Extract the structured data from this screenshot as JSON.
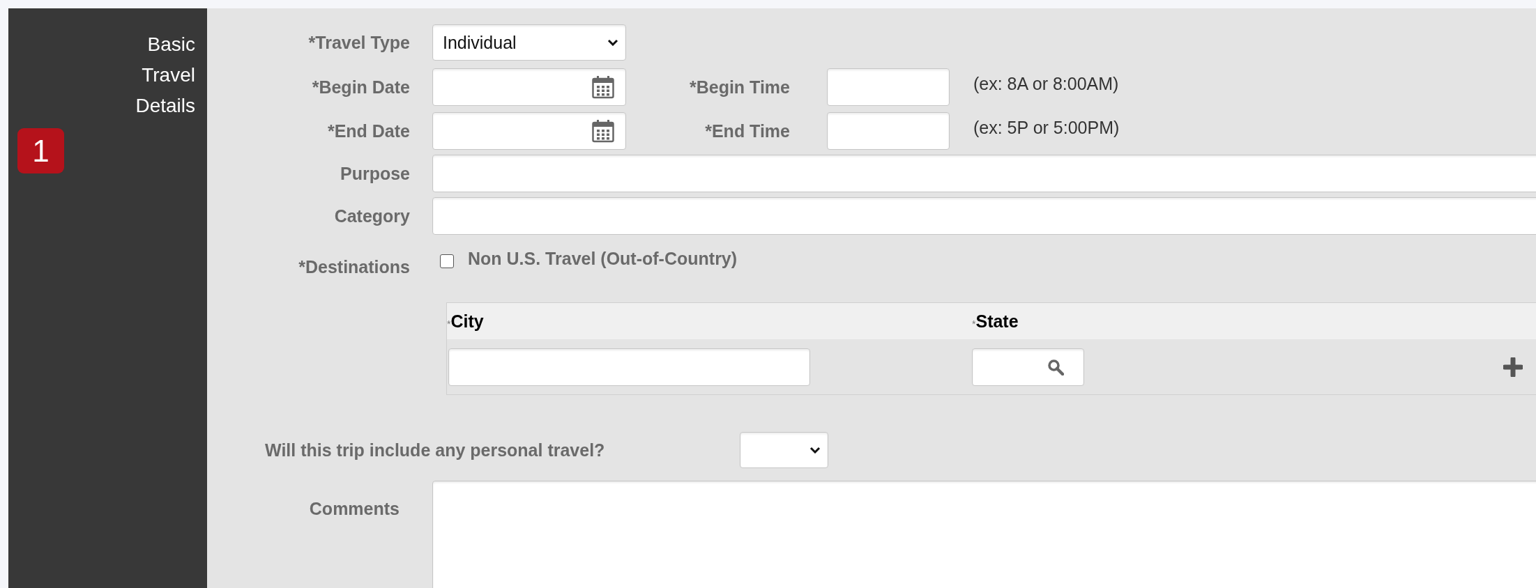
{
  "sidebar": {
    "title": "Basic Travel Details",
    "step": "1"
  },
  "travel_type": {
    "label": "*Travel Type",
    "value": "Individual"
  },
  "schedule": [
    {
      "date_label": "*Begin Date",
      "time_label": "*Begin Time",
      "hint": "(ex: 8A or 8:00AM)"
    },
    {
      "date_label": "*End Date",
      "time_label": "*End Time",
      "hint": "(ex: 5P or 5:00PM)"
    }
  ],
  "text_fields": [
    {
      "label": "Purpose"
    },
    {
      "label": "Category"
    }
  ],
  "destinations": {
    "label": "*Destinations",
    "option": {
      "label": "Non U.S. Travel (Out-of-Country)",
      "checked": false
    },
    "columns": [
      {
        "marker": "*",
        "label": "City"
      },
      {
        "marker": "*",
        "label": "State"
      }
    ]
  },
  "personal_travel": {
    "label": "Will this trip include any personal travel?"
  },
  "comments": {
    "label": "Comments"
  }
}
